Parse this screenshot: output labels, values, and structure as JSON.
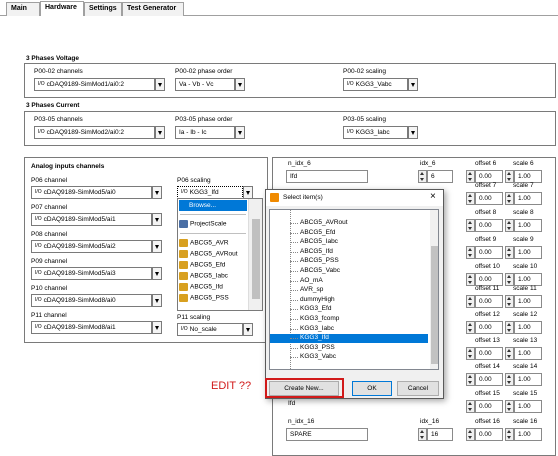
{
  "tabs": [
    "Main",
    "Hardware",
    "Settings",
    "Test Generator"
  ],
  "active_tab": "Hardware",
  "voltage": {
    "title": "3 Phases Voltage",
    "channels_label": "P00-02 channels",
    "channels_value": "cDAQ9189-SimMod1/ai0:2",
    "order_label": "P00-02 phase order",
    "order_value": "Va - Vb - Vc",
    "scaling_label": "P00-02 scaling",
    "scaling_value": "KGG3_Vabc"
  },
  "current": {
    "title": "3 Phases Current",
    "channels_label": "P03-05 channels",
    "channels_value": "cDAQ9189-SimMod2/ai0:2",
    "order_label": "P03-05 phase order",
    "order_value": "Ia - Ib - Ic",
    "scaling_label": "P03-05 scaling",
    "scaling_value": "KGG3_Iabc"
  },
  "analog": {
    "title": "Analog inputs channels",
    "channels": [
      {
        "label": "P06 channel",
        "value": "cDAQ9189-SimMod5/ai0"
      },
      {
        "label": "P07 channel",
        "value": "cDAQ9189-SimMod5/ai1"
      },
      {
        "label": "P08 channel",
        "value": "cDAQ9189-SimMod5/ai2"
      },
      {
        "label": "P09 channel",
        "value": "cDAQ9189-SimMod5/ai3"
      },
      {
        "label": "P10 channel",
        "value": "cDAQ9189-SimMod8/ai0"
      },
      {
        "label": "P11 channel",
        "value": "cDAQ9189-SimMod8/ai1"
      }
    ],
    "p06_scaling_label": "P06 scaling",
    "p06_scaling_value": "KGG3_Ifd",
    "p11_scaling_label": "P11 scaling",
    "p11_scaling_value": "No_scale"
  },
  "dropdown": {
    "browse": "Browse...",
    "items": [
      "ProjectScale",
      "ABCG5_AVR",
      "ABCG5_AVRout",
      "ABCG5_Efd",
      "ABCG5_Iabc",
      "ABCG5_Ifd",
      "ABCG5_PSS"
    ]
  },
  "right_panel": {
    "n_idx_6_label": "n_idx_6",
    "n_idx_6_value": "Ifd",
    "idx_6_label": "idx_6",
    "idx_6_value": "6",
    "n_idx_16_label": "n_idx_16",
    "n_idx_16_value": "SPARE",
    "idx_16_label": "idx_16",
    "idx_16_value": "16",
    "truncated_label": "Ifd",
    "offsets": [
      {
        "offset_label": "offset 6",
        "offset_value": "0.00",
        "scale_label": "scale 6",
        "scale_value": "1.00"
      },
      {
        "offset_label": "offset 7",
        "offset_value": "0.00",
        "scale_label": "scale 7",
        "scale_value": "1.00"
      },
      {
        "offset_label": "offset 8",
        "offset_value": "0.00",
        "scale_label": "scale 8",
        "scale_value": "1.00"
      },
      {
        "offset_label": "offset 9",
        "offset_value": "0.00",
        "scale_label": "scale 9",
        "scale_value": "1.00"
      },
      {
        "offset_label": "offset 10",
        "offset_value": "0.00",
        "scale_label": "scale 10",
        "scale_value": "1.00"
      },
      {
        "offset_label": "offset 11",
        "offset_value": "0.00",
        "scale_label": "scale 11",
        "scale_value": "1.00"
      },
      {
        "offset_label": "offset 12",
        "offset_value": "0.00",
        "scale_label": "scale 12",
        "scale_value": "1.00"
      },
      {
        "offset_label": "offset 13",
        "offset_value": "0.00",
        "scale_label": "scale 13",
        "scale_value": "1.00"
      },
      {
        "offset_label": "offset 14",
        "offset_value": "0.00",
        "scale_label": "scale 14",
        "scale_value": "1.00"
      },
      {
        "offset_label": "offset 15",
        "offset_value": "0.00",
        "scale_label": "scale 15",
        "scale_value": "1.00"
      },
      {
        "offset_label": "offset 16",
        "offset_value": "0.00",
        "scale_label": "scale 16",
        "scale_value": "1.00"
      }
    ]
  },
  "dialog": {
    "title": "Select item(s)",
    "close": "×",
    "items": [
      "ABCG5_AVRout",
      "ABCG5_Efd",
      "ABCG5_Iabc",
      "ABCG5_Ifd",
      "ABCG5_PSS",
      "ABCG5_Vabc",
      "AO_mA",
      "AVR_sp",
      "dummyHigh",
      "KGG3_Efd",
      "KGG3_fcomp",
      "KGG3_Iabc",
      "KGG3_Ifd",
      "KGG3_PSS",
      "KGG3_Vabc"
    ],
    "selected": "KGG3_Ifd",
    "create_new": "Create New...",
    "ok": "OK",
    "cancel": "Cancel"
  },
  "annotation": "EDIT ??",
  "colors": {
    "selection": "#0078d7",
    "annotation": "#d11a1a",
    "dialog_bg": "#f0f0f0"
  }
}
